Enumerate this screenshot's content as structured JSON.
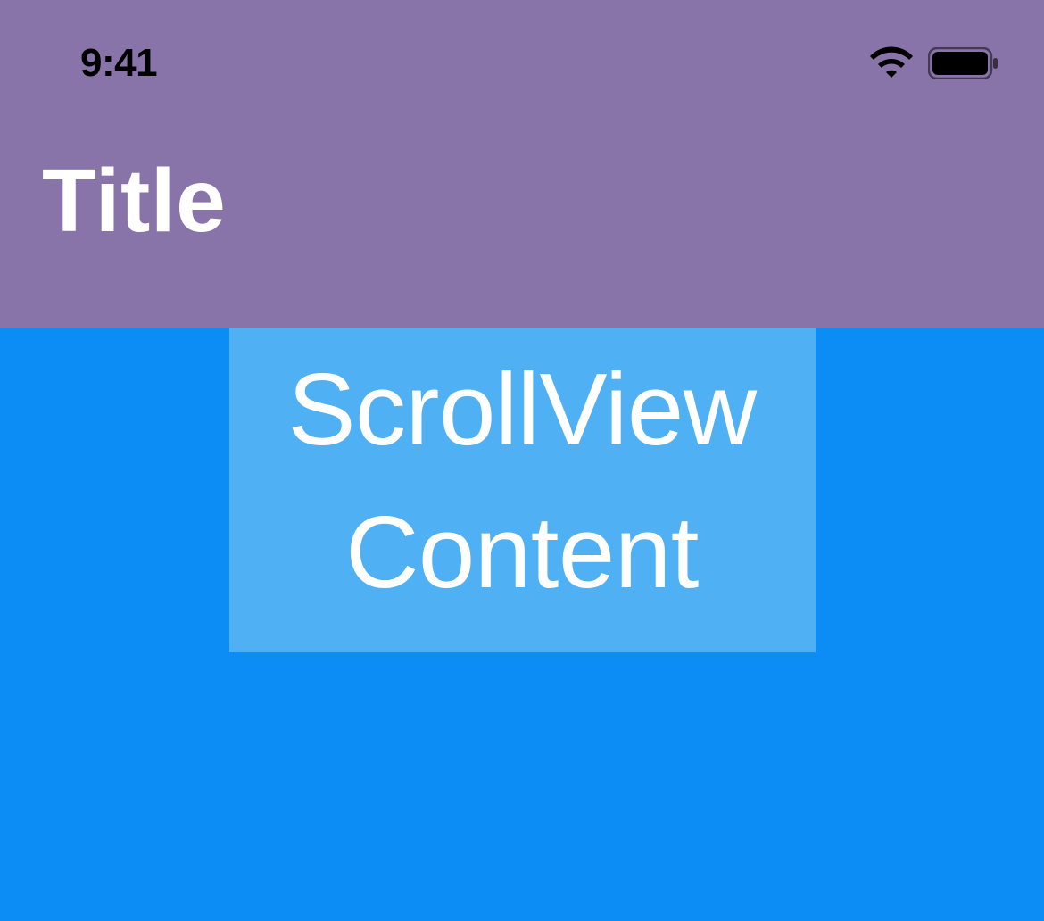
{
  "statusBar": {
    "time": "9:41"
  },
  "navigation": {
    "title": "Title"
  },
  "scrollView": {
    "contentLine1": "ScrollView",
    "contentLine2": "Content"
  },
  "colors": {
    "headerBackground": "#8974aa",
    "bodyBackground": "#0c8df5",
    "contentBoxBackground": "#4fb1f3",
    "titleText": "#ffffff",
    "contentText": "#ffffff",
    "statusText": "#000000"
  }
}
